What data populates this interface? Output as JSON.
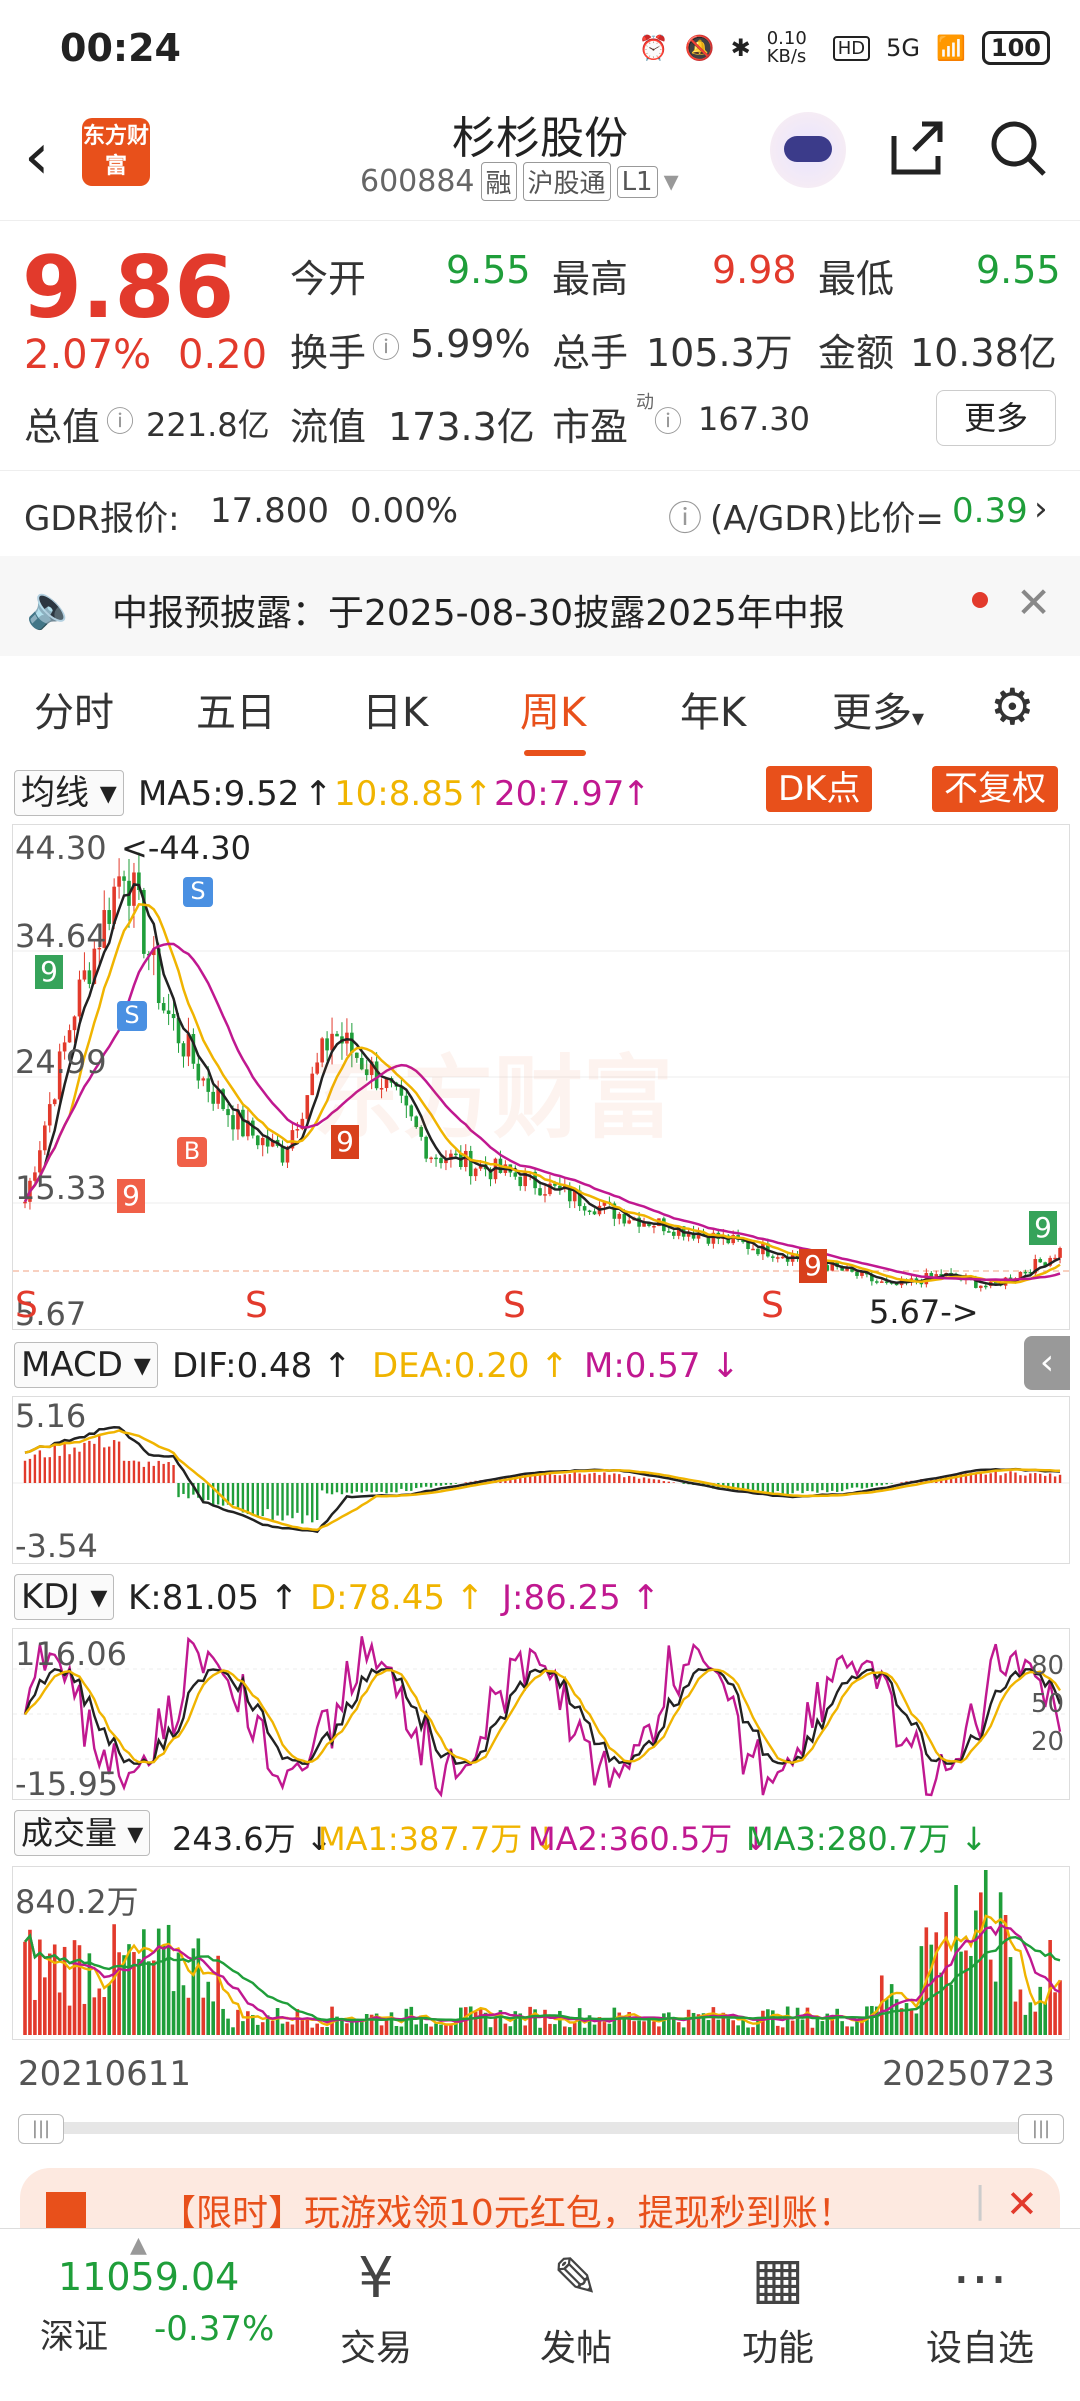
{
  "status": {
    "time": "00:24",
    "net_speed": "0.10 KB/s",
    "signal": "5G",
    "battery": "100"
  },
  "header": {
    "stock_name": "杉杉股份",
    "code": "600884",
    "tag1": "融",
    "tag2": "沪股通",
    "tag3": "L1",
    "logo_text": "东方财富"
  },
  "quote": {
    "price": "9.86",
    "change_pct": "2.07%",
    "change": "0.20",
    "open_label": "今开",
    "open": "9.55",
    "high_label": "最高",
    "high": "9.98",
    "low_label": "最低",
    "low": "9.55",
    "turnover_label": "换手",
    "turnover": "5.99%",
    "volume_label": "总手",
    "volume": "105.3万",
    "amount_label": "金额",
    "amount": "10.38亿",
    "mktcap_label": "总值",
    "mktcap": "221.8亿",
    "float_label": "流值",
    "float": "173.3亿",
    "pe_label": "市盈",
    "pe_sup": "动",
    "pe": "167.30",
    "more_label": "更多"
  },
  "gdr": {
    "label": "GDR报价:",
    "price": "17.800",
    "pct": "0.00%",
    "ratio_label": "(A/GDR)比价=",
    "ratio": "0.39"
  },
  "notice": {
    "text": "中报预披露：于2025-08-30披露2025年中报"
  },
  "tabs": [
    "分时",
    "五日",
    "日K",
    "周K",
    "年K",
    "更多"
  ],
  "ma_bar": {
    "select": "均线",
    "ma5": "MA5:9.52",
    "ma10": "10:8.85",
    "ma20": "20:7.97",
    "dk": "DK点",
    "fuquan": "不复权"
  },
  "kline": {
    "high_label": "44.30",
    "high_marker": "<-44.30",
    "lvl2": "34.64",
    "lvl3": "24.99",
    "lvl4": "15.33",
    "low_label": "5.67",
    "low_marker": "5.67->"
  },
  "macd_bar": {
    "select": "MACD",
    "dif": "DIF:0.48",
    "dea": "DEA:0.20",
    "m": "M:0.57",
    "top": "5.16",
    "bottom": "-3.54"
  },
  "kdj_bar": {
    "select": "KDJ",
    "k": "K:81.05",
    "d": "D:78.45",
    "j": "J:86.25",
    "top": "116.06",
    "bottom": "-15.95",
    "r80": "80",
    "r50": "50",
    "r20": "20"
  },
  "vol_bar": {
    "select": "成交量",
    "vol": "243.6万",
    "ma1": "MA1:387.7万",
    "ma2": "MA2:360.5万",
    "ma3": "MA3:280.7万",
    "top": "840.2万"
  },
  "dates": {
    "start": "20210611",
    "end": "20250723"
  },
  "banner": {
    "text": "【限时】玩游戏领10元红包，提现秒到账！"
  },
  "bottom": {
    "index_value": "11059.04",
    "index_name": "深证",
    "index_pct": "-0.37%",
    "trade": "交易",
    "post": "发帖",
    "func": "功能",
    "watch": "设自选"
  },
  "colors": {
    "up": "#e23a2c",
    "down": "#1f9e3a",
    "accent": "#e8501b"
  }
}
